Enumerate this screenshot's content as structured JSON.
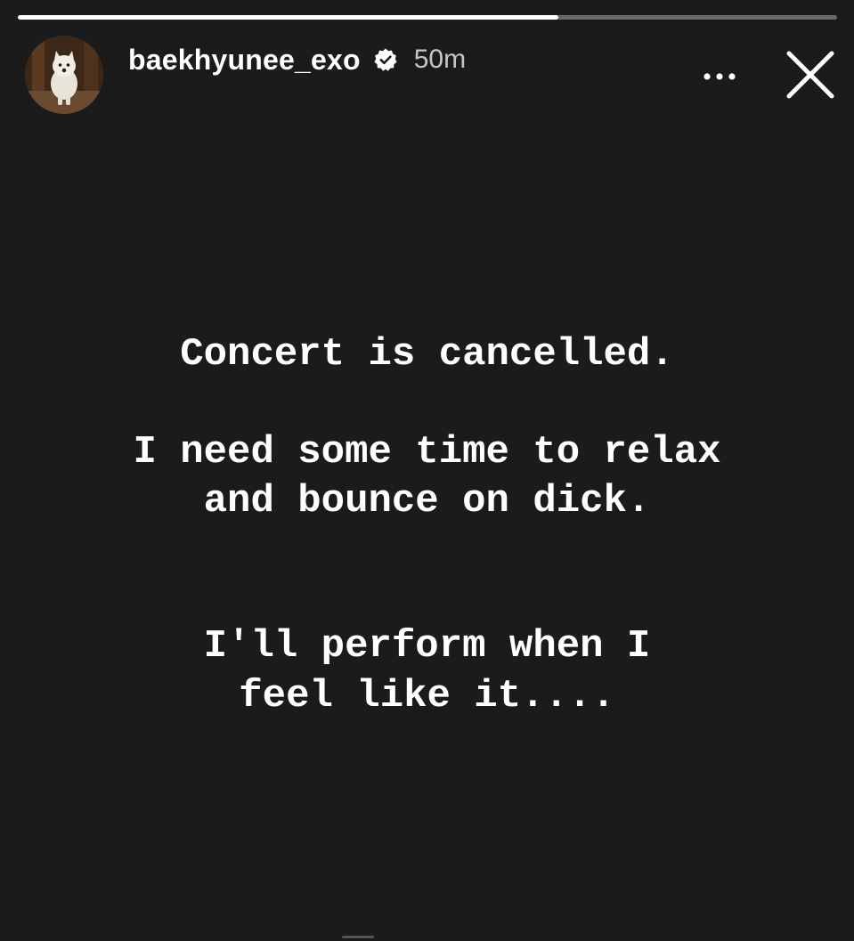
{
  "story": {
    "progress": 0.66,
    "background_color": "#1b1b1b"
  },
  "header": {
    "username": "baekhyunee_exo",
    "verified": true,
    "timestamp": "50m",
    "more_icon": "more-horizontal-icon",
    "close_icon": "close-icon"
  },
  "content": {
    "line1": "Concert is cancelled.",
    "line2": "I need some time to relax",
    "line3": "and bounce on dick.",
    "line4": "I'll perform when I",
    "line5": "feel like it...."
  }
}
